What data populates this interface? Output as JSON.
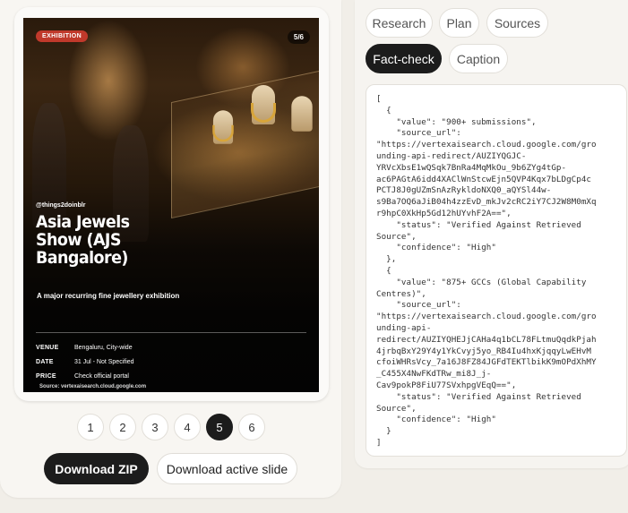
{
  "slide": {
    "category": "EXHIBITION",
    "counter": "5/6",
    "handle": "@things2doinblr",
    "title": "Asia Jewels Show (AJS Bangalore)",
    "subtitle": "A major recurring fine jewellery exhibition",
    "meta": [
      {
        "key": "VENUE",
        "value": "Bengaluru, City-wide"
      },
      {
        "key": "DATE",
        "value": "31 Jul - Not Specified"
      },
      {
        "key": "PRICE",
        "value": "Check official portal"
      }
    ],
    "source": "Source: vertexaisearch.cloud.google.com"
  },
  "pager": {
    "pages": [
      "1",
      "2",
      "3",
      "4",
      "5",
      "6"
    ],
    "active": "5"
  },
  "actions": {
    "download_zip": "Download ZIP",
    "download_active": "Download active slide"
  },
  "tabs": {
    "research": "Research",
    "plan": "Plan",
    "sources": "Sources",
    "fact_check": "Fact-check",
    "caption": "Caption"
  },
  "active_tab": "Fact-check",
  "fact_check_json": "[\n  {\n    \"value\": \"900+ submissions\",\n    \"source_url\":\n\"https://vertexaisearch.cloud.google.com/gro\nunding-api-redirect/AUZIYQGJC-\nYRVcXbsE1wQSqk7BnRa4MqMkOu_9b6ZYg4tGp-\nac6PAGtA6idd4XAClWnStcwEjn5QVP4Kqx7bLDgCp4c\nPCTJ8J0gUZmSnAzRykldoNXQ0_aQYSl44w-\ns9Ba7OQ6aJiB04h4zzEvD_mkJv2cRC2iY7CJ2W8M0mXq\nr9hpC0XkHp5Gd12hUYvhF2A==\",\n    \"status\": \"Verified Against Retrieved\nSource\",\n    \"confidence\": \"High\"\n  },\n  {\n    \"value\": \"875+ GCCs (Global Capability\nCentres)\",\n    \"source_url\":\n\"https://vertexaisearch.cloud.google.com/gro\nunding-api-\nredirect/AUZIYQHEJjCAHa4q1bCL78FLtmuQqdkPjah\n4jrbqBxY29Y4y1YkCvyj5yo_RB4Iu4hxKjqqyLwEHvM\ncfoiWHRsVcy_7a16J8FZ84JGFdTEKTlbikK9mOPdXhMY\n_C455X4NwFKdTRw_mi8J_j-\nCav9pokP8FiU77SVxhpgVEqQ==\",\n    \"status\": \"Verified Against Retrieved\nSource\",\n    \"confidence\": \"High\"\n  }\n]"
}
